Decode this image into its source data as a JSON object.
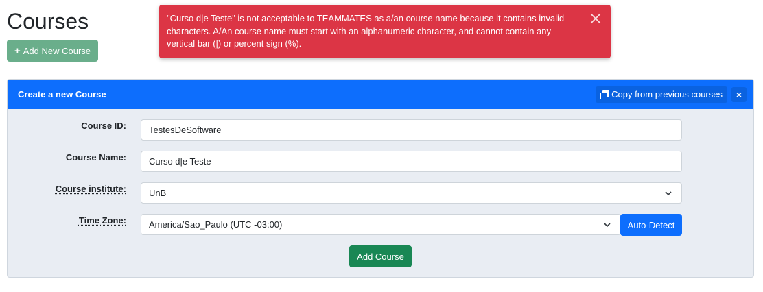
{
  "page": {
    "title": "Courses",
    "add_button_label": "Add New Course"
  },
  "alert": {
    "message": "\"Curso d|e Teste\" is not acceptable to TEAMMATES as a/an course name because it contains invalid characters. A/An course name must start with an alphanumeric character, and cannot contain any vertical bar (|) or percent sign (%).",
    "color": "#dc3545"
  },
  "panel": {
    "title": "Create a new Course",
    "copy_button_label": "Copy from previous courses",
    "close_label": "×",
    "header_color": "#0d6efd"
  },
  "form": {
    "course_id": {
      "label": "Course ID:",
      "value": "TestesDeSoftware"
    },
    "course_name": {
      "label": "Course Name:",
      "value": "Curso d|e Teste"
    },
    "institute": {
      "label": "Course institute:",
      "value": "UnB"
    },
    "time_zone": {
      "label": "Time Zone:",
      "value": "America/Sao_Paulo (UTC -03:00)",
      "auto_detect_label": "Auto-Detect"
    },
    "submit_label": "Add Course"
  },
  "icons": [
    "plus-icon",
    "close-icon",
    "copy-icon",
    "chevron-down-icon"
  ]
}
